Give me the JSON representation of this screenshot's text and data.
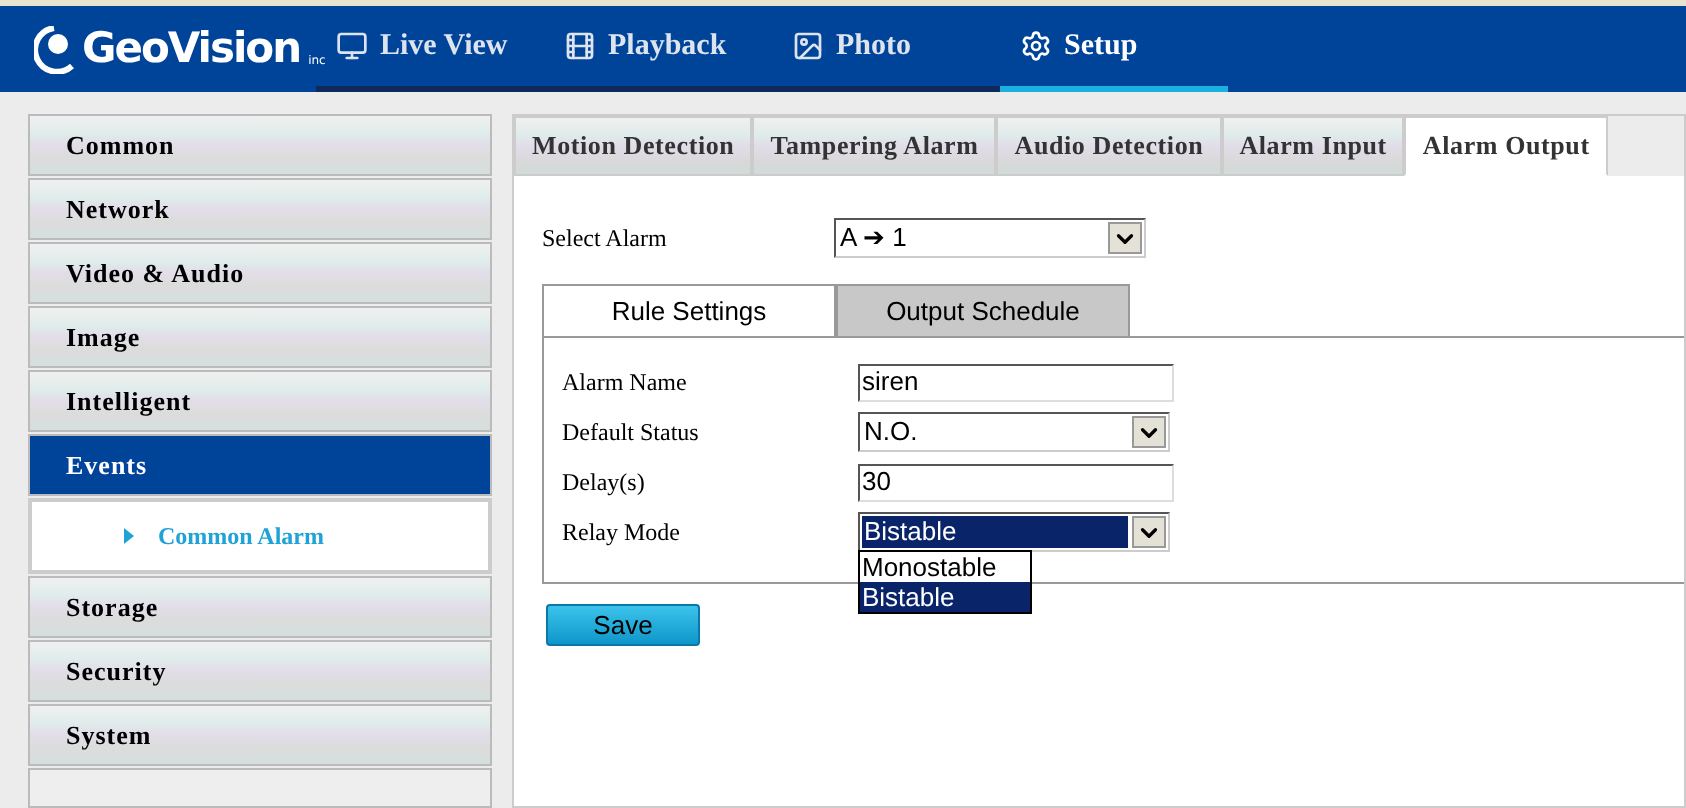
{
  "header": {
    "logo": {
      "name": "GeoVision",
      "suffix": "inc"
    },
    "nav": [
      {
        "label": "Live View",
        "kind": "monitor",
        "selected": false
      },
      {
        "label": "Playback",
        "kind": "film",
        "selected": false
      },
      {
        "label": "Photo",
        "kind": "image",
        "selected": false
      },
      {
        "label": "Setup",
        "kind": "gear",
        "selected": true
      }
    ]
  },
  "sidebar": {
    "items": [
      {
        "label": "Common",
        "selected": false
      },
      {
        "label": "Network",
        "selected": false
      },
      {
        "label": "Video & Audio",
        "selected": false
      },
      {
        "label": "Image",
        "selected": false
      },
      {
        "label": "Intelligent",
        "selected": false
      },
      {
        "label": "Events",
        "selected": true,
        "children": [
          {
            "label": "Common Alarm"
          }
        ]
      },
      {
        "label": "Storage",
        "selected": false
      },
      {
        "label": "Security",
        "selected": false
      },
      {
        "label": "System",
        "selected": false
      }
    ]
  },
  "tabs": [
    {
      "label": "Motion Detection",
      "selected": false
    },
    {
      "label": "Tampering Alarm",
      "selected": false
    },
    {
      "label": "Audio Detection",
      "selected": false
    },
    {
      "label": "Alarm Input",
      "selected": false
    },
    {
      "label": "Alarm Output",
      "selected": true
    }
  ],
  "select_alarm": {
    "label": "Select Alarm",
    "value": "A ➔ 1"
  },
  "subtabs": [
    {
      "label": "Rule Settings",
      "selected": true
    },
    {
      "label": "Output Schedule",
      "selected": false
    }
  ],
  "fields": [
    {
      "kind": "text",
      "label": "Alarm Name",
      "value": "siren"
    },
    {
      "kind": "select",
      "label": "Default Status",
      "value": "N.O."
    },
    {
      "kind": "text",
      "label": "Delay(s)",
      "value": "30"
    },
    {
      "kind": "select",
      "label": "Relay Mode",
      "value": "Bistable",
      "expanded": true,
      "options": [
        {
          "label": "Monostable",
          "selected": false
        },
        {
          "label": "Bistable",
          "selected": true
        }
      ]
    }
  ],
  "save_button": "Save"
}
